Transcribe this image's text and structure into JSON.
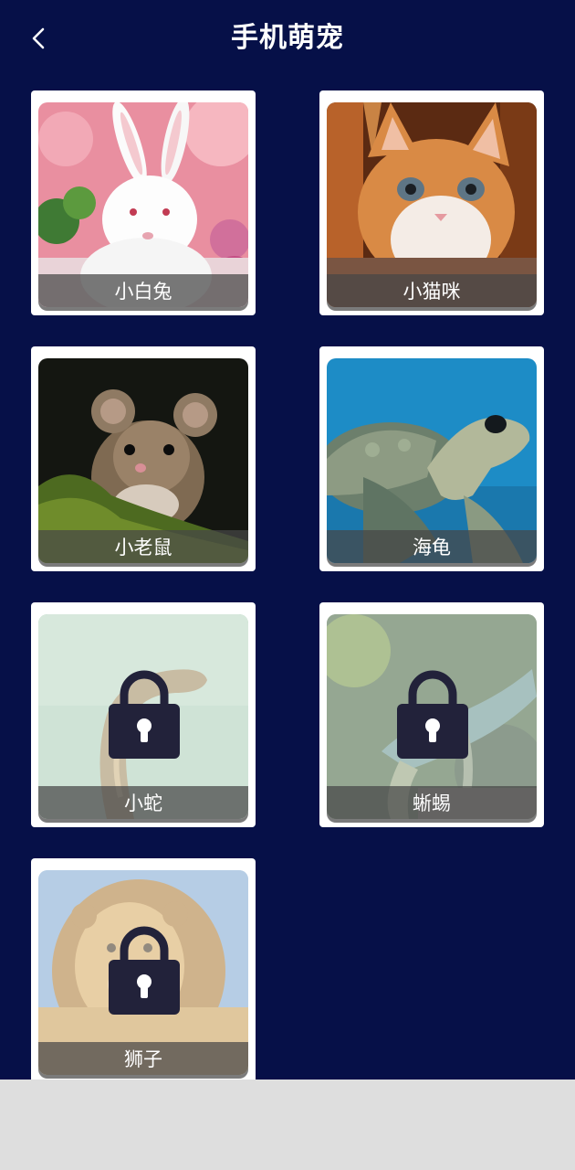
{
  "header": {
    "title": "手机萌宠",
    "back_icon": "chevron-left-icon"
  },
  "colors": {
    "background": "#061048",
    "card": "#ffffff",
    "label_bar": "#464646",
    "lock": "#22223a",
    "bottom_area": "#dedede"
  },
  "pets": [
    {
      "name": "小白兔",
      "locked": false,
      "image": "white rabbit with pink flowers"
    },
    {
      "name": "小猫咪",
      "locked": false,
      "image": "orange kitten in a basket"
    },
    {
      "name": "小老鼠",
      "locked": false,
      "image": "mouse on moss"
    },
    {
      "name": "海龟",
      "locked": false,
      "image": "sea turtle on blue water"
    },
    {
      "name": "小蛇",
      "locked": true,
      "image": "snake",
      "lock_icon": "padlock-icon"
    },
    {
      "name": "蜥蜴",
      "locked": true,
      "image": "chameleon on branch",
      "lock_icon": "padlock-icon"
    },
    {
      "name": "狮子",
      "locked": true,
      "image": "lion",
      "lock_icon": "padlock-icon"
    }
  ]
}
